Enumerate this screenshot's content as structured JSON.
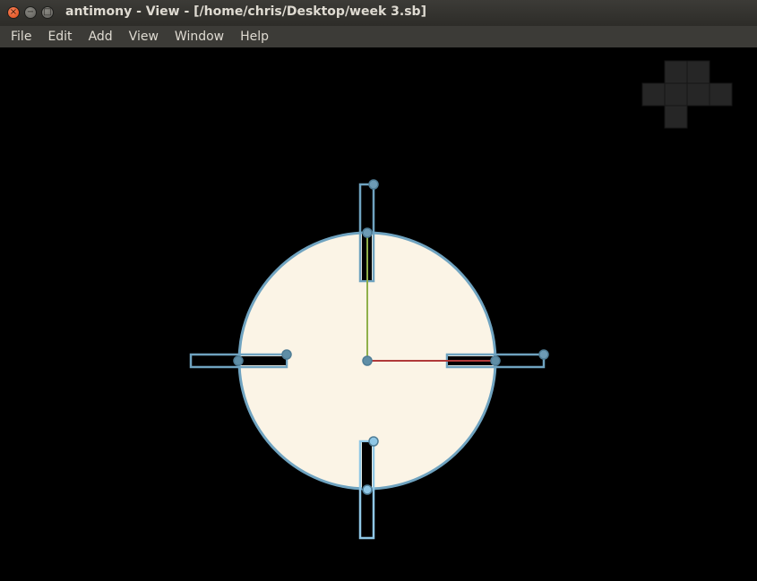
{
  "window": {
    "title": "antimony - View - [/home/chris/Desktop/week 3.sb]",
    "close_glyph": "×",
    "minimize_glyph": "−",
    "maximize_glyph": "□"
  },
  "menu": {
    "items": [
      {
        "label": "File"
      },
      {
        "label": "Edit"
      },
      {
        "label": "Add"
      },
      {
        "label": "View"
      },
      {
        "label": "Window"
      },
      {
        "label": "Help"
      }
    ]
  },
  "viewport": {
    "background": "#000000",
    "disk_fill": "#fbf4e6",
    "outline_color": "#6fa3c0",
    "handle_color": "#5f8ea6",
    "x_axis_color": "#b03a3a",
    "y_axis_color": "#8fb04a",
    "view_cube_color": "#262626",
    "icons": [
      "view-cube-icon",
      "origin-handle",
      "axis-x",
      "axis-y"
    ]
  }
}
